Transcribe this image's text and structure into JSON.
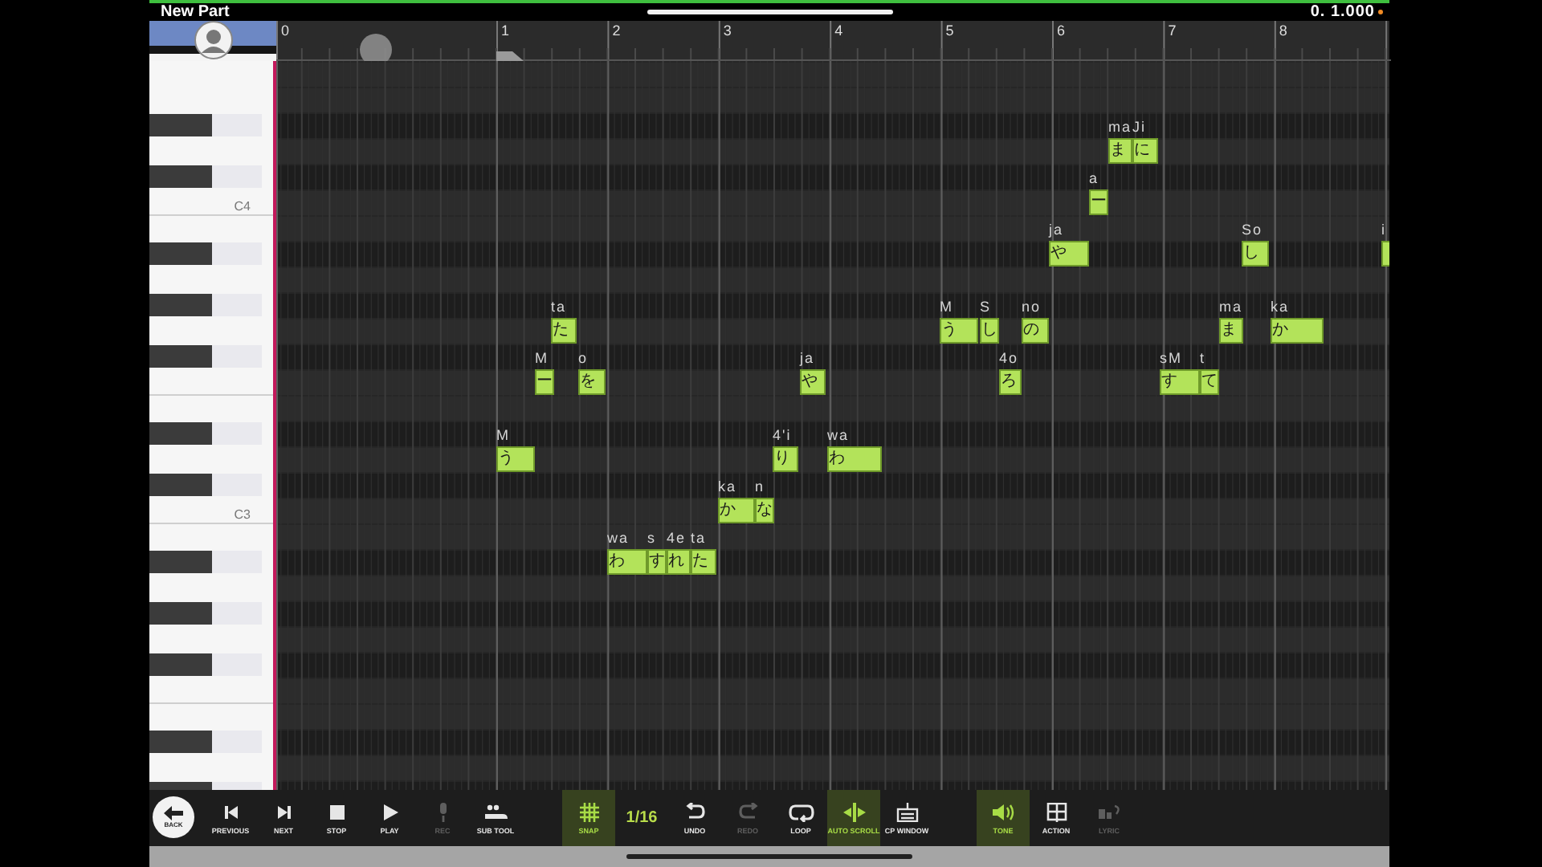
{
  "top_bar": {
    "title": "New Part",
    "position": "0. 1.000"
  },
  "ruler": {
    "measures": [
      "0",
      "1",
      "2",
      "3",
      "4",
      "5",
      "6",
      "7",
      "8"
    ]
  },
  "keyboard": {
    "labels": [
      "C4",
      "C3"
    ]
  },
  "notes": [
    {
      "lyric": "う",
      "phoneme": "M"
    },
    {
      "lyric": "ー",
      "phoneme": "M"
    },
    {
      "lyric": "た",
      "phoneme": "ta"
    },
    {
      "lyric": "を",
      "phoneme": "o"
    },
    {
      "lyric": "わ",
      "phoneme": "wa"
    },
    {
      "lyric": "す",
      "phoneme": "s"
    },
    {
      "lyric": "れ",
      "phoneme": "4e"
    },
    {
      "lyric": "た",
      "phoneme": "ta"
    },
    {
      "lyric": "か",
      "phoneme": "ka"
    },
    {
      "lyric": "な",
      "phoneme": "n"
    },
    {
      "lyric": "り",
      "phoneme": "4'i"
    },
    {
      "lyric": "や",
      "phoneme": "ja"
    },
    {
      "lyric": "わ",
      "phoneme": "wa"
    },
    {
      "lyric": "う",
      "phoneme": "M"
    },
    {
      "lyric": "し",
      "phoneme": "S"
    },
    {
      "lyric": "ろ",
      "phoneme": "4o"
    },
    {
      "lyric": "の",
      "phoneme": "no"
    },
    {
      "lyric": "や",
      "phoneme": "ja"
    },
    {
      "lyric": "ー",
      "phoneme": "a"
    },
    {
      "lyric": "ま",
      "phoneme": "ma"
    },
    {
      "lyric": "に",
      "phoneme": "Ji"
    },
    {
      "lyric": "す",
      "phoneme": "sM"
    },
    {
      "lyric": "て",
      "phoneme": "t"
    },
    {
      "lyric": "ま",
      "phoneme": "ma"
    },
    {
      "lyric": "し",
      "phoneme": "So"
    },
    {
      "lyric": "か",
      "phoneme": "ka"
    },
    {
      "phoneme": "i"
    }
  ],
  "toolbar": {
    "back": {
      "label": "BACK"
    },
    "items": [
      {
        "kind": "button",
        "label": "PREVIOUS",
        "active": false,
        "disabled": false
      },
      {
        "kind": "button",
        "label": "NEXT",
        "active": false,
        "disabled": false
      },
      {
        "kind": "button",
        "label": "STOP",
        "active": false,
        "disabled": false
      },
      {
        "kind": "button",
        "label": "PLAY",
        "active": false,
        "disabled": false
      },
      {
        "kind": "button",
        "label": "REC",
        "active": false,
        "disabled": true
      },
      {
        "kind": "button",
        "label": "SUB TOOL",
        "active": false,
        "disabled": false
      },
      {
        "kind": "button",
        "label": "SNAP",
        "active": true,
        "disabled": false
      },
      {
        "kind": "value",
        "label": "1/16"
      },
      {
        "kind": "button",
        "label": "UNDO",
        "active": false,
        "disabled": false
      },
      {
        "kind": "button",
        "label": "REDO",
        "active": false,
        "disabled": true
      },
      {
        "kind": "button",
        "label": "LOOP",
        "active": false,
        "disabled": false
      },
      {
        "kind": "button",
        "label": "AUTO SCROLL",
        "active": true,
        "disabled": false
      },
      {
        "kind": "button",
        "label": "CP WINDOW",
        "active": false,
        "disabled": false
      },
      {
        "kind": "button",
        "label": "TONE",
        "active": true,
        "disabled": false
      },
      {
        "kind": "button",
        "label": "ACTION",
        "active": false,
        "disabled": false
      },
      {
        "kind": "button",
        "label": "LYRIC",
        "active": false,
        "disabled": true
      }
    ]
  }
}
